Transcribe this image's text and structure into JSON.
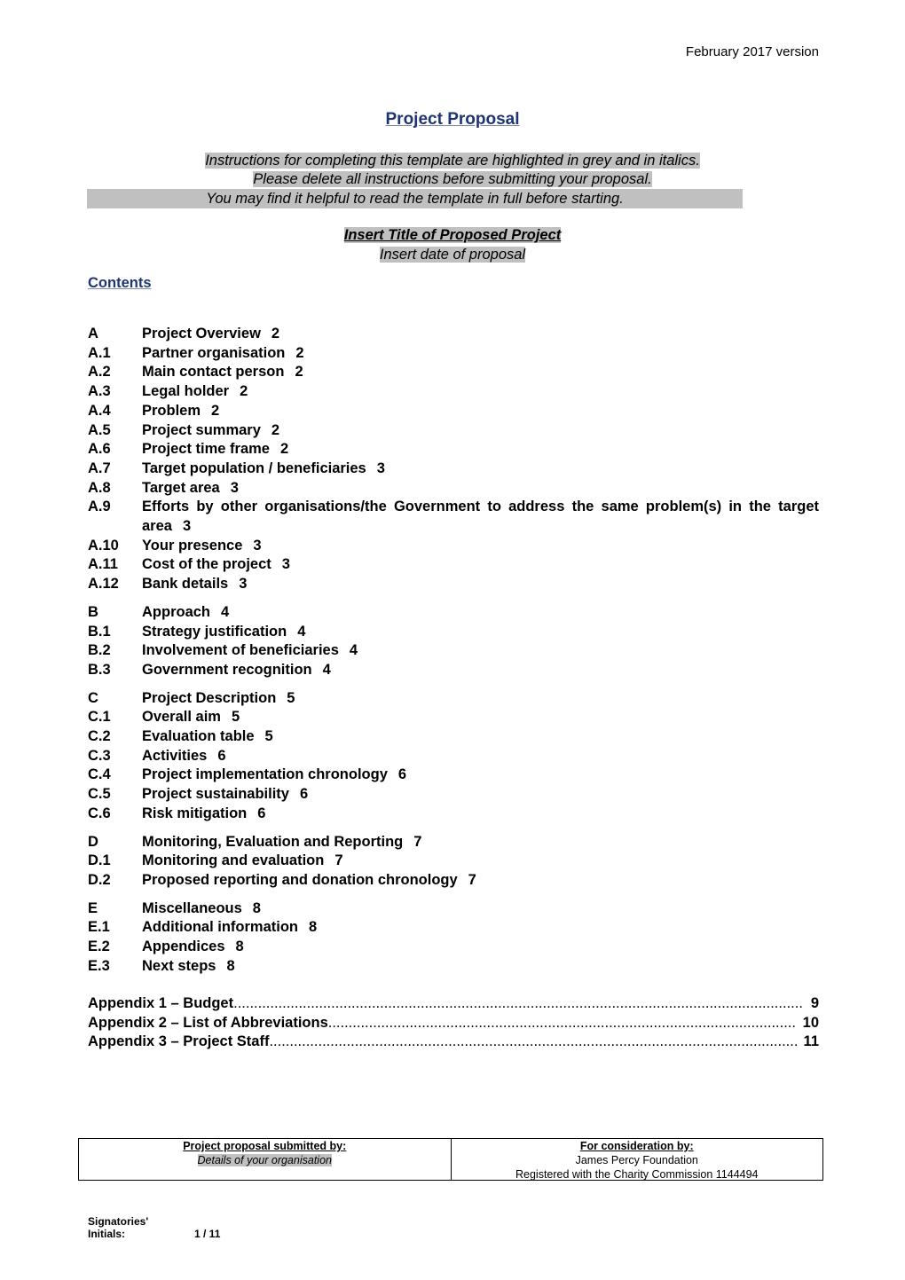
{
  "header": {
    "version": "February 2017 version"
  },
  "title": "Project Proposal",
  "instructions": [
    "Instructions for completing this template are highlighted in grey and in italics.",
    "Please delete all instructions before submitting your proposal.",
    "You may find it helpful to read the template in full before starting."
  ],
  "proposal": {
    "title_placeholder": "Insert Title of Proposed Project",
    "date_placeholder": "Insert date of proposal"
  },
  "contents_heading": "Contents",
  "toc": [
    {
      "num": "A",
      "text": "Project Overview",
      "page": "2"
    },
    {
      "num": "A.1",
      "text": "Partner organisation",
      "page": "2"
    },
    {
      "num": "A.2",
      "text": "Main contact person",
      "page": "2"
    },
    {
      "num": "A.3",
      "text": "Legal holder",
      "page": "2"
    },
    {
      "num": "A.4",
      "text": "Problem",
      "page": "2"
    },
    {
      "num": "A.5",
      "text": "Project summary",
      "page": "2"
    },
    {
      "num": "A.6",
      "text": "Project time frame",
      "page": "2"
    },
    {
      "num": "A.7",
      "text": "Target population / beneficiaries",
      "page": "3"
    },
    {
      "num": "A.8",
      "text": "Target area",
      "page": "3"
    },
    {
      "num": "A.9",
      "text": "Efforts by other organisations/the Government to address the same problem(s) in the target area",
      "page": "3"
    },
    {
      "num": "A.10",
      "text": "Your presence",
      "page": "3"
    },
    {
      "num": "A.11",
      "text": "Cost of the project",
      "page": "3"
    },
    {
      "num": "A.12",
      "text": "Bank details",
      "page": "3"
    },
    {
      "num": "B",
      "text": "Approach",
      "page": "4"
    },
    {
      "num": "B.1",
      "text": "Strategy justification",
      "page": "4"
    },
    {
      "num": "B.2",
      "text": "Involvement of beneficiaries",
      "page": "4"
    },
    {
      "num": "B.3",
      "text": "Government recognition",
      "page": "4"
    },
    {
      "num": "C",
      "text": "Project Description",
      "page": "5"
    },
    {
      "num": "C.1",
      "text": "Overall aim",
      "page": "5"
    },
    {
      "num": "C.2",
      "text": "Evaluation table",
      "page": "5"
    },
    {
      "num": "C.3",
      "text": "Activities",
      "page": "6"
    },
    {
      "num": "C.4",
      "text": "Project implementation chronology",
      "page": "6"
    },
    {
      "num": "C.5",
      "text": "Project sustainability",
      "page": "6"
    },
    {
      "num": "C.6",
      "text": "Risk mitigation",
      "page": "6"
    },
    {
      "num": "D",
      "text": "Monitoring, Evaluation and Reporting",
      "page": "7"
    },
    {
      "num": "D.1",
      "text": "Monitoring and evaluation",
      "page": "7"
    },
    {
      "num": "D.2",
      "text": "Proposed reporting and donation chronology",
      "page": "7"
    },
    {
      "num": "E",
      "text": "Miscellaneous",
      "page": "8"
    },
    {
      "num": "E.1",
      "text": "Additional information",
      "page": "8"
    },
    {
      "num": "E.2",
      "text": "Appendices",
      "page": "8"
    },
    {
      "num": "E.3",
      "text": "Next steps",
      "page": "8"
    }
  ],
  "appendices": [
    {
      "label": "Appendix 1 – Budget",
      "page": "9"
    },
    {
      "label": "Appendix 2 – List of Abbreviations",
      "page": "10"
    },
    {
      "label": "Appendix 3 – Project Staff",
      "page": "11"
    }
  ],
  "submission": {
    "submitted_by_heading": "Project proposal submitted by:",
    "submitted_by_value": "Details of your organisation",
    "consideration_heading": "For consideration by:",
    "consideration_org": "James Percy Foundation",
    "consideration_reg": "Registered with the Charity Commission 1144494"
  },
  "footer": {
    "signatories_line1": "Signatories'",
    "signatories_line2": "Initials:",
    "page_indicator": "1 / 11"
  }
}
